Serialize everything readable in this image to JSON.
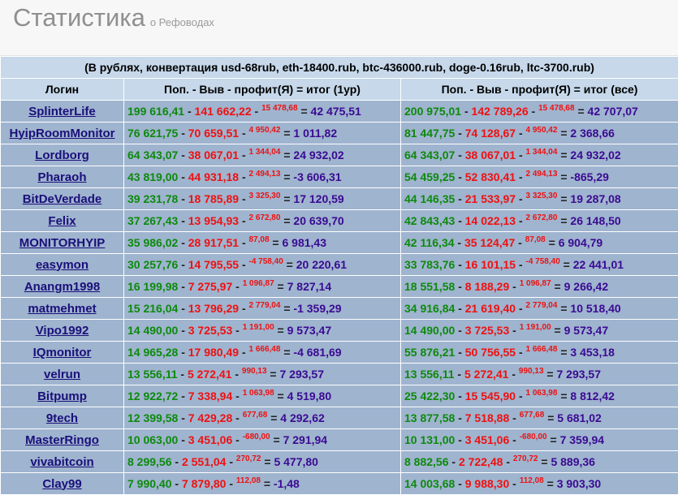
{
  "header": {
    "title": "Статистика",
    "subtitle": "о Рефоводах"
  },
  "table": {
    "caption": "(В рублях, конвертация usd-68rub, eth-18400.rub, btc-436000.rub, doge-0.16rub, ltc-3700.rub)",
    "col_login": "Логин",
    "col_1": "Поп. - Выв - профит(Я) = итог (1ур)",
    "col_2": "Поп. - Выв - профит(Я) = итог (все)",
    "rows": [
      {
        "login": "SplinterLife",
        "a": {
          "pop": "199 616,41",
          "out": "141 662,22",
          "profit": "15 478,68",
          "total": "42 475,51"
        },
        "b": {
          "pop": "200 975,01",
          "out": "142 789,26",
          "profit": "15 478,68",
          "total": "42 707,07"
        }
      },
      {
        "login": "HyipRoomMonitor",
        "a": {
          "pop": "76 621,75",
          "out": "70 659,51",
          "profit": "4 950,42",
          "total": "1 011,82"
        },
        "b": {
          "pop": "81 447,75",
          "out": "74 128,67",
          "profit": "4 950,42",
          "total": "2 368,66"
        }
      },
      {
        "login": "Lordborg",
        "a": {
          "pop": "64 343,07",
          "out": "38 067,01",
          "profit": "1 344,04",
          "total": "24 932,02"
        },
        "b": {
          "pop": "64 343,07",
          "out": "38 067,01",
          "profit": "1 344,04",
          "total": "24 932,02"
        }
      },
      {
        "login": "Pharaoh",
        "a": {
          "pop": "43 819,00",
          "out": "44 931,18",
          "profit": "2 494,13",
          "total": "-3 606,31"
        },
        "b": {
          "pop": "54 459,25",
          "out": "52 830,41",
          "profit": "2 494,13",
          "total": "-865,29"
        }
      },
      {
        "login": "BitDeVerdade",
        "a": {
          "pop": "39 231,78",
          "out": "18 785,89",
          "profit": "3 325,30",
          "total": "17 120,59"
        },
        "b": {
          "pop": "44 146,35",
          "out": "21 533,97",
          "profit": "3 325,30",
          "total": "19 287,08"
        }
      },
      {
        "login": "Felix",
        "a": {
          "pop": "37 267,43",
          "out": "13 954,93",
          "profit": "2 672,80",
          "total": "20 639,70"
        },
        "b": {
          "pop": "42 843,43",
          "out": "14 022,13",
          "profit": "2 672,80",
          "total": "26 148,50"
        }
      },
      {
        "login": "MONITORHYIP",
        "a": {
          "pop": "35 986,02",
          "out": "28 917,51",
          "profit": "87,08",
          "total": "6 981,43"
        },
        "b": {
          "pop": "42 116,34",
          "out": "35 124,47",
          "profit": "87,08",
          "total": "6 904,79"
        }
      },
      {
        "login": "easymon",
        "a": {
          "pop": "30 257,76",
          "out": "14 795,55",
          "profit": "-4 758,40",
          "total": "20 220,61"
        },
        "b": {
          "pop": "33 783,76",
          "out": "16 101,15",
          "profit": "-4 758,40",
          "total": "22 441,01"
        }
      },
      {
        "login": "Anangm1998",
        "a": {
          "pop": "16 199,98",
          "out": "7 275,97",
          "profit": "1 096,87",
          "total": "7 827,14"
        },
        "b": {
          "pop": "18 551,58",
          "out": "8 188,29",
          "profit": "1 096,87",
          "total": "9 266,42"
        }
      },
      {
        "login": "matmehmet",
        "a": {
          "pop": "15 216,04",
          "out": "13 796,29",
          "profit": "2 779,04",
          "total": "-1 359,29"
        },
        "b": {
          "pop": "34 916,84",
          "out": "21 619,40",
          "profit": "2 779,04",
          "total": "10 518,40"
        }
      },
      {
        "login": "Vipo1992",
        "a": {
          "pop": "14 490,00",
          "out": "3 725,53",
          "profit": "1 191,00",
          "total": "9 573,47"
        },
        "b": {
          "pop": "14 490,00",
          "out": "3 725,53",
          "profit": "1 191,00",
          "total": "9 573,47"
        }
      },
      {
        "login": "IQmonitor",
        "a": {
          "pop": "14 965,28",
          "out": "17 980,49",
          "profit": "1 666,48",
          "total": "-4 681,69"
        },
        "b": {
          "pop": "55 876,21",
          "out": "50 756,55",
          "profit": "1 666,48",
          "total": "3 453,18"
        }
      },
      {
        "login": "velrun",
        "a": {
          "pop": "13 556,11",
          "out": "5 272,41",
          "profit": "990,13",
          "total": "7 293,57"
        },
        "b": {
          "pop": "13 556,11",
          "out": "5 272,41",
          "profit": "990,13",
          "total": "7 293,57"
        }
      },
      {
        "login": "Bitpump",
        "a": {
          "pop": "12 922,72",
          "out": "7 338,94",
          "profit": "1 063,98",
          "total": "4 519,80"
        },
        "b": {
          "pop": "25 422,30",
          "out": "15 545,90",
          "profit": "1 063,98",
          "total": "8 812,42"
        }
      },
      {
        "login": "9tech",
        "a": {
          "pop": "12 399,58",
          "out": "7 429,28",
          "profit": "677,68",
          "total": "4 292,62"
        },
        "b": {
          "pop": "13 877,58",
          "out": "7 518,88",
          "profit": "677,68",
          "total": "5 681,02"
        }
      },
      {
        "login": "MasterRingo",
        "a": {
          "pop": "10 063,00",
          "out": "3 451,06",
          "profit": "-680,00",
          "total": "7 291,94"
        },
        "b": {
          "pop": "10 131,00",
          "out": "3 451,06",
          "profit": "-680,00",
          "total": "7 359,94"
        }
      },
      {
        "login": "vivabitcoin",
        "a": {
          "pop": "8 299,56",
          "out": "2 551,04",
          "profit": "270,72",
          "total": "5 477,80"
        },
        "b": {
          "pop": "8 882,56",
          "out": "2 722,48",
          "profit": "270,72",
          "total": "5 889,36"
        }
      },
      {
        "login": "Clay99",
        "a": {
          "pop": "7 990,40",
          "out": "7 879,80",
          "profit": "112,08",
          "total": "-1,48"
        },
        "b": {
          "pop": "14 003,68",
          "out": "9 988,30",
          "profit": "112,08",
          "total": "3 903,30"
        }
      }
    ]
  }
}
